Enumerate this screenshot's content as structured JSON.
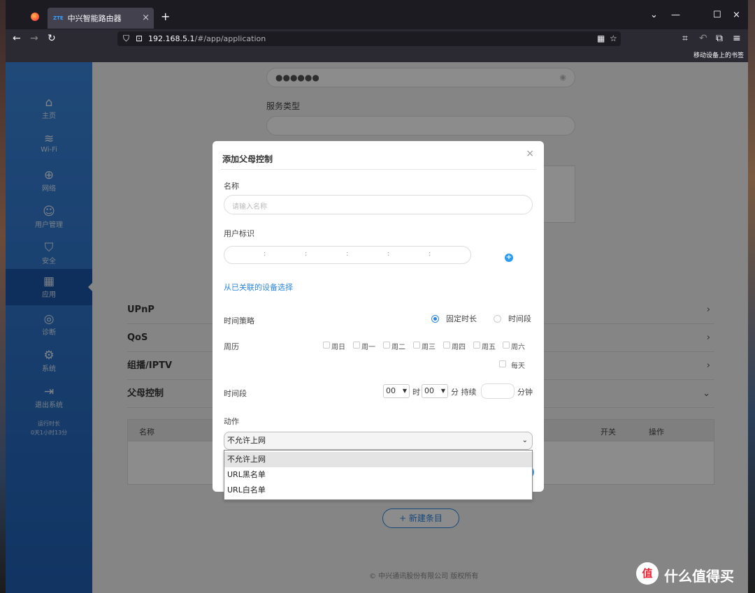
{
  "browser": {
    "tab_title": "中兴智能路由器",
    "tab_favicon": "ZTE",
    "url_host": "192.168.5.1",
    "url_path": "/#/app/application",
    "mobile_bookmarks": "移动设备上的书签"
  },
  "sidebar": {
    "items": [
      {
        "label": "主页",
        "icon": "⌂"
      },
      {
        "label": "Wi-Fi",
        "icon": "≋"
      },
      {
        "label": "网络",
        "icon": "⊕"
      },
      {
        "label": "用户管理",
        "icon": "☺"
      },
      {
        "label": "安全",
        "icon": "⛉"
      },
      {
        "label": "应用",
        "icon": "▦"
      },
      {
        "label": "诊断",
        "icon": "◎"
      },
      {
        "label": "系统",
        "icon": "⚙"
      },
      {
        "label": "退出系统",
        "icon": "⇥"
      }
    ],
    "uptime_label": "运行时长",
    "uptime_value": "0天1小时13分"
  },
  "background": {
    "password_mask": "●●●●●●",
    "service_type_label": "服务类型",
    "accordion": [
      {
        "label": "UPnP",
        "chev": "›"
      },
      {
        "label": "QoS",
        "chev": "›"
      },
      {
        "label": "组播/IPTV",
        "chev": "›"
      },
      {
        "label": "父母控制",
        "chev": "⌄"
      }
    ],
    "table_headers": {
      "name": "名称",
      "switch": "开关",
      "ops": "操作"
    },
    "new_entry": "+ 新建条目",
    "footer": "© 中兴通讯股份有限公司 版权所有"
  },
  "modal": {
    "title": "添加父母控制",
    "close": "×",
    "name_label": "名称",
    "name_placeholder": "请输入名称",
    "user_id_label": "用户标识",
    "select_from_devices": "从已关联的设备选择",
    "time_policy_label": "时间策略",
    "policy_fixed": "固定时长",
    "policy_period": "时间段",
    "calendar_label": "周历",
    "days": [
      "周日",
      "周一",
      "周二",
      "周三",
      "周四",
      "周五",
      "周六"
    ],
    "everyday": "每天",
    "time_range_label": "时间段",
    "hour_value": "00",
    "hour_unit": "时",
    "minute_value": "00",
    "minute_unit": "分 持续",
    "minutes_unit": "分钟",
    "action_label": "动作",
    "action_selected": "不允许上网",
    "action_options": [
      "不允许上网",
      "URL黑名单",
      "URL白名单"
    ]
  },
  "watermark": {
    "logo": "值",
    "text": "什么值得买"
  }
}
